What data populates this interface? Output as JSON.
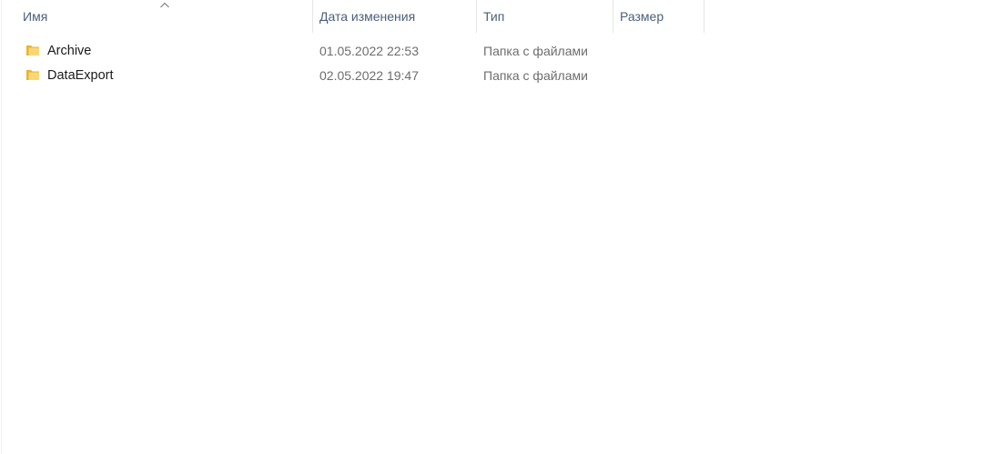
{
  "columns": {
    "name": "Имя",
    "date_modified": "Дата изменения",
    "type": "Тип",
    "size": "Размер"
  },
  "sort": {
    "column": "name",
    "direction": "ascending",
    "icon": "chevron-up-icon"
  },
  "files": [
    {
      "name": "Archive",
      "date_modified": "01.05.2022 22:53",
      "type": "Папка с файлами",
      "size": "",
      "icon": "folder-icon"
    },
    {
      "name": "DataExport",
      "date_modified": "02.05.2022 19:47",
      "type": "Папка с файлами",
      "size": "",
      "icon": "folder-icon"
    }
  ],
  "colors": {
    "header_text": "#4c607a",
    "folder_yellow": "#f8d775",
    "folder_dark": "#e8b430",
    "secondary_text": "#6d6d6d"
  }
}
